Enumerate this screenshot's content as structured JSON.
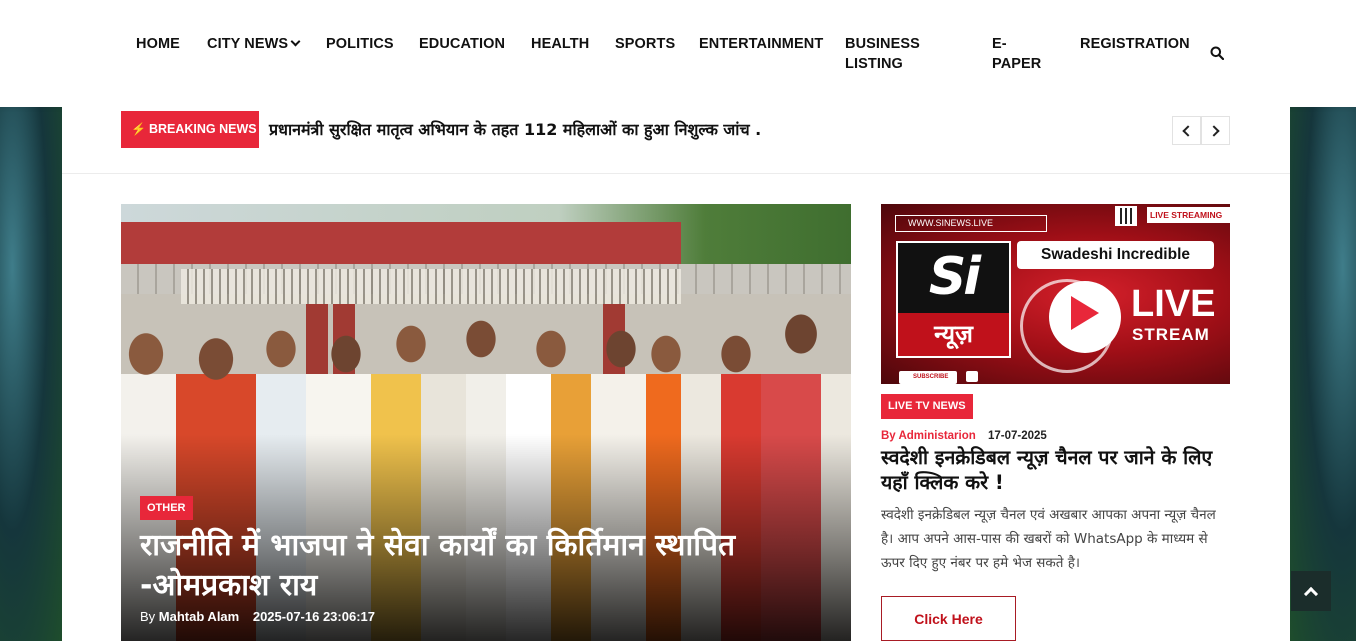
{
  "nav": {
    "items": [
      {
        "label": "HOME"
      },
      {
        "label": "CITY NEWS"
      },
      {
        "label": "POLITICS"
      },
      {
        "label": "EDUCATION"
      },
      {
        "label": "HEALTH"
      },
      {
        "label": "SPORTS"
      },
      {
        "label": "ENTERTAINMENT"
      },
      {
        "label": "BUSINESS LISTING"
      },
      {
        "label": "E-PAPER"
      },
      {
        "label": "REGISTRATION"
      }
    ],
    "search_icon": "search-icon"
  },
  "breaking": {
    "tag": "BREAKING NEWS",
    "text": "प्रधानमंत्री सुरक्षित मातृत्व अभियान के तहत 112 महिलाओं का हुआ निशुल्क जांच ."
  },
  "featured": {
    "category": "OTHER",
    "title": "राजनीति में भाजपा ने सेवा कार्यों का किर्तिमान स्थापित -ओमप्रकाश राय",
    "by": "By",
    "author": "Mahtab Alam",
    "date": "2025-07-16 23:06:17"
  },
  "sidebar": {
    "banner": {
      "url": "WWW.SINEWS.LIVE",
      "live_tag": "LIVE STREAMING",
      "si": "Si",
      "news": "न्यूज़",
      "channel": "Swadeshi Incredible",
      "live": "LIVE",
      "stream": "STREAM",
      "subscribe": "SUBSCRIBE"
    },
    "category": "LIVE TV NEWS",
    "author": "By Administarion",
    "date": "17-07-2025",
    "title": "स्वदेशी इनक्रेडिबल न्यूज़ चैनल पर जाने के लिए यहाँ क्लिक करे !",
    "excerpt": "स्वदेशी इनक्रेडिबल न्यूज़ चैनल एवं अखबार आपका अपना न्यूज़ चैनल है। आप अपने आस-पास की खबरों को WhatsApp के माध्यम से ऊपर दिए हुए नंबर पर हमे भेज सकते है।",
    "button": "Click Here"
  },
  "colors": {
    "accent": "#e8273a",
    "nav_text": "#111111",
    "back_to_top_bg": "#1b2d2b"
  }
}
